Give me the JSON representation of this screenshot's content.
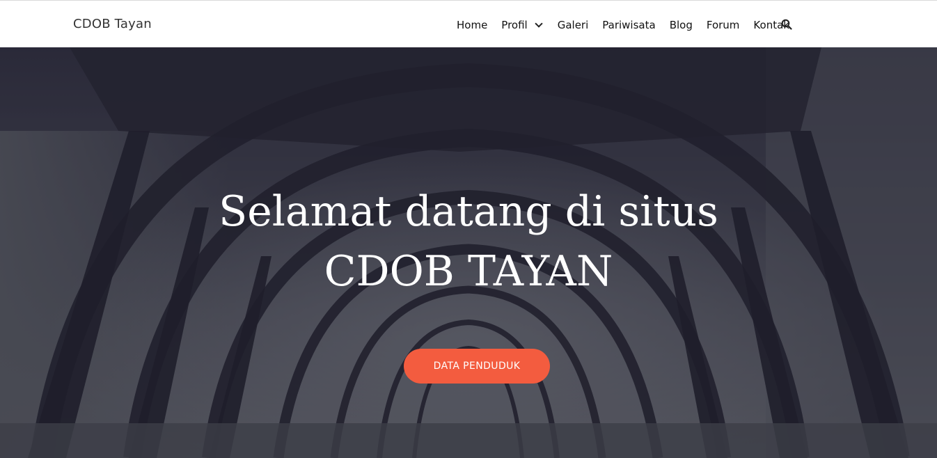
{
  "header": {
    "brand": "CDOB Tayan",
    "nav": {
      "home": "Home",
      "profil": "Profil",
      "galeri": "Galeri",
      "pariwisata": "Pariwisata",
      "blog": "Blog",
      "forum": "Forum",
      "kontak": "Kontak"
    },
    "search_icon": "search-icon",
    "dropdown_icon": "chevron-down-icon"
  },
  "hero": {
    "title_line1": "Selamat datang di situs",
    "title_line2": "CDOB TAYAN",
    "cta_label": "DATA PENDUDUK"
  },
  "colors": {
    "accent": "#f35c3f",
    "header_bg": "#ffffff",
    "text_dark": "#111111"
  }
}
